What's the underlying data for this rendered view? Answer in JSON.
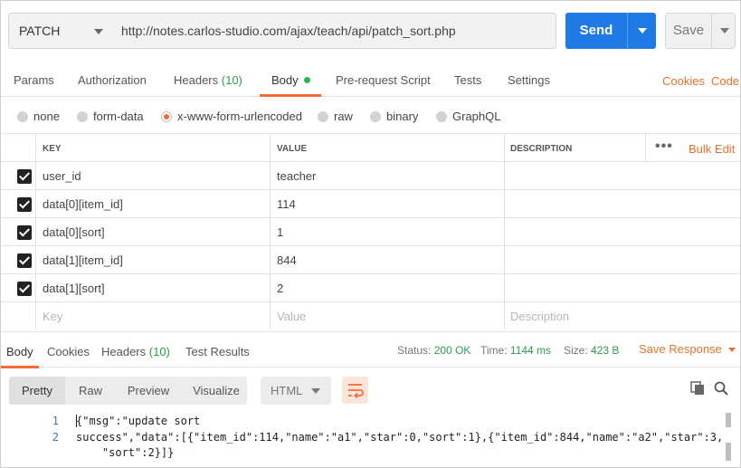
{
  "request": {
    "method": "PATCH",
    "url": "http://notes.carlos-studio.com/ajax/teach/api/patch_sort.php",
    "send_label": "Send",
    "save_label": "Save"
  },
  "tabs": {
    "params": "Params",
    "authorization": "Authorization",
    "headers": "Headers",
    "headers_count": "(10)",
    "body": "Body",
    "prerequest": "Pre-request Script",
    "tests": "Tests",
    "settings": "Settings",
    "cookies": "Cookies",
    "code": "Code"
  },
  "body_types": {
    "none": "none",
    "form_data": "form-data",
    "urlencoded": "x-www-form-urlencoded",
    "raw": "raw",
    "binary": "binary",
    "graphql": "GraphQL",
    "selected": "x-www-form-urlencoded"
  },
  "table": {
    "headers": {
      "key": "KEY",
      "value": "VALUE",
      "description": "DESCRIPTION",
      "more": "•••",
      "bulk_edit": "Bulk Edit"
    },
    "rows": [
      {
        "key": "user_id",
        "value": "teacher",
        "description": ""
      },
      {
        "key": "data[0][item_id]",
        "value": "114",
        "description": ""
      },
      {
        "key": "data[0][sort]",
        "value": "1",
        "description": ""
      },
      {
        "key": "data[1][item_id]",
        "value": "844",
        "description": ""
      },
      {
        "key": "data[1][sort]",
        "value": "2",
        "description": ""
      }
    ],
    "placeholder": {
      "key": "Key",
      "value": "Value",
      "description": "Description"
    }
  },
  "response": {
    "tabs": {
      "body": "Body",
      "cookies": "Cookies",
      "headers": "Headers",
      "headers_count": "(10)",
      "test_results": "Test Results"
    },
    "status_label": "Status:",
    "status_value": "200 OK",
    "time_label": "Time:",
    "time_value": "1144 ms",
    "size_label": "Size:",
    "size_value": "423 B",
    "save_response": "Save Response"
  },
  "viewer": {
    "modes": [
      "Pretty",
      "Raw",
      "Preview",
      "Visualize"
    ],
    "active_mode": "Pretty",
    "format": "HTML"
  },
  "code": {
    "line_numbers": [
      "1",
      "2"
    ],
    "lines": [
      "{\"msg\":\"update sort",
      "success\",\"data\":[{\"item_id\":114,\"name\":\"a1\",\"star\":0,\"sort\":1},{\"item_id\":844,\"name\":\"a2\",\"star\":3,",
      "    \"sort\":2}]}"
    ]
  },
  "colors": {
    "accent": "#f26b3a",
    "primary": "#1f7ae6",
    "success": "#2a9d4a"
  }
}
